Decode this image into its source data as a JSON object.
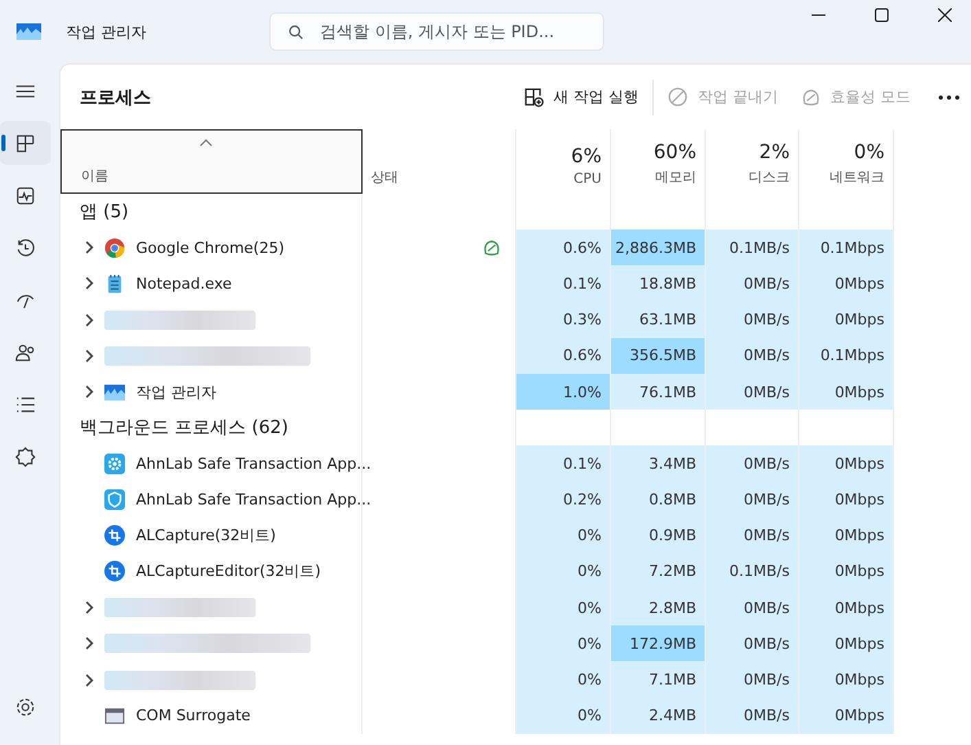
{
  "window": {
    "title": "작업 관리자"
  },
  "search": {
    "placeholder": "검색할 이름, 게시자 또는 PID..."
  },
  "nav": [
    {
      "selected": false
    },
    {
      "selected": true
    },
    {
      "selected": false
    },
    {
      "selected": false
    },
    {
      "selected": false
    },
    {
      "selected": false
    },
    {
      "selected": false
    },
    {
      "selected": false
    },
    {
      "selected": false
    }
  ],
  "page_title": "프로세스",
  "toolbar": [
    {
      "label": "새 작업 실행",
      "disabled": false
    },
    {
      "label": "작업 끝내기",
      "disabled": true
    },
    {
      "label": "효율성 모드",
      "disabled": true
    }
  ],
  "columns": [
    {
      "label": "이름",
      "sorted": true
    },
    {
      "label": "상태"
    },
    {
      "percent": "6%",
      "label": "CPU"
    },
    {
      "percent": "60%",
      "label": "메모리"
    },
    {
      "percent": "2%",
      "label": "디스크"
    },
    {
      "percent": "0%",
      "label": "네트워크"
    }
  ],
  "groups": [
    {
      "title": "앱 (5)",
      "rows": [
        {
          "kind": "chrome",
          "name": "Google Chrome(25)",
          "expandable": true,
          "redacted": false,
          "efficiency_mode": true,
          "cells": [
            {
              "text": "0.6%",
              "high": false
            },
            {
              "text": "2,886.3MB",
              "high": true
            },
            {
              "text": "0.1MB/s",
              "high": false
            },
            {
              "text": "0.1Mbps",
              "high": false
            }
          ]
        },
        {
          "kind": "notepad",
          "name": "Notepad.exe",
          "expandable": true,
          "redacted": false,
          "efficiency_mode": false,
          "cells": [
            {
              "text": "0.1%",
              "high": false
            },
            {
              "text": "18.8MB",
              "high": false
            },
            {
              "text": "0MB/s",
              "high": false
            },
            {
              "text": "0Mbps",
              "high": false
            }
          ]
        },
        {
          "expandable": true,
          "redacted": true,
          "efficiency_mode": false,
          "cells": [
            {
              "text": "0.3%",
              "high": false
            },
            {
              "text": "63.1MB",
              "high": false
            },
            {
              "text": "0MB/s",
              "high": false
            },
            {
              "text": "0Mbps",
              "high": false
            }
          ]
        },
        {
          "expandable": true,
          "redacted": true,
          "efficiency_mode": false,
          "cells": [
            {
              "text": "0.6%",
              "high": false
            },
            {
              "text": "356.5MB",
              "high": true
            },
            {
              "text": "0MB/s",
              "high": false
            },
            {
              "text": "0.1Mbps",
              "high": false
            }
          ]
        },
        {
          "kind": "taskmgr",
          "name": "작업 관리자",
          "expandable": true,
          "redacted": false,
          "efficiency_mode": false,
          "cells": [
            {
              "text": "1.0%",
              "high": true
            },
            {
              "text": "76.1MB",
              "high": false
            },
            {
              "text": "0MB/s",
              "high": false
            },
            {
              "text": "0Mbps",
              "high": false
            }
          ]
        }
      ]
    },
    {
      "title": "백그라운드 프로세스 (62)",
      "rows": [
        {
          "kind": "gear",
          "name": "AhnLab Safe Transaction App...",
          "expandable": false,
          "redacted": false,
          "efficiency_mode": false,
          "cells": [
            {
              "text": "0.1%",
              "high": false
            },
            {
              "text": "3.4MB",
              "high": false
            },
            {
              "text": "0MB/s",
              "high": false
            },
            {
              "text": "0Mbps",
              "high": false
            }
          ]
        },
        {
          "kind": "shield",
          "name": "AhnLab Safe Transaction App...",
          "expandable": false,
          "redacted": false,
          "efficiency_mode": false,
          "cells": [
            {
              "text": "0.2%",
              "high": false
            },
            {
              "text": "0.8MB",
              "high": false
            },
            {
              "text": "0MB/s",
              "high": false
            },
            {
              "text": "0Mbps",
              "high": false
            }
          ]
        },
        {
          "kind": "crop",
          "name": "ALCapture(32비트)",
          "expandable": false,
          "redacted": false,
          "efficiency_mode": false,
          "cells": [
            {
              "text": "0%",
              "high": false
            },
            {
              "text": "0.9MB",
              "high": false
            },
            {
              "text": "0MB/s",
              "high": false
            },
            {
              "text": "0Mbps",
              "high": false
            }
          ]
        },
        {
          "kind": "crop",
          "name": "ALCaptureEditor(32비트)",
          "expandable": false,
          "redacted": false,
          "efficiency_mode": false,
          "cells": [
            {
              "text": "0%",
              "high": false
            },
            {
              "text": "7.2MB",
              "high": false
            },
            {
              "text": "0.1MB/s",
              "high": false
            },
            {
              "text": "0Mbps",
              "high": false
            }
          ]
        },
        {
          "expandable": true,
          "redacted": true,
          "efficiency_mode": false,
          "cells": [
            {
              "text": "0%",
              "high": false
            },
            {
              "text": "2.8MB",
              "high": false
            },
            {
              "text": "0MB/s",
              "high": false
            },
            {
              "text": "0Mbps",
              "high": false
            }
          ]
        },
        {
          "expandable": true,
          "redacted": true,
          "efficiency_mode": false,
          "cells": [
            {
              "text": "0%",
              "high": false
            },
            {
              "text": "172.9MB",
              "high": true
            },
            {
              "text": "0MB/s",
              "high": false
            },
            {
              "text": "0Mbps",
              "high": false
            }
          ]
        },
        {
          "expandable": true,
          "redacted": true,
          "efficiency_mode": false,
          "cells": [
            {
              "text": "0%",
              "high": false
            },
            {
              "text": "7.1MB",
              "high": false
            },
            {
              "text": "0MB/s",
              "high": false
            },
            {
              "text": "0Mbps",
              "high": false
            }
          ]
        },
        {
          "kind": "window",
          "name": "COM Surrogate",
          "expandable": false,
          "redacted": false,
          "efficiency_mode": false,
          "cells": [
            {
              "text": "0%",
              "high": false
            },
            {
              "text": "2.4MB",
              "high": false
            },
            {
              "text": "0MB/s",
              "high": false
            },
            {
              "text": "0Mbps",
              "high": false
            }
          ]
        }
      ]
    }
  ]
}
